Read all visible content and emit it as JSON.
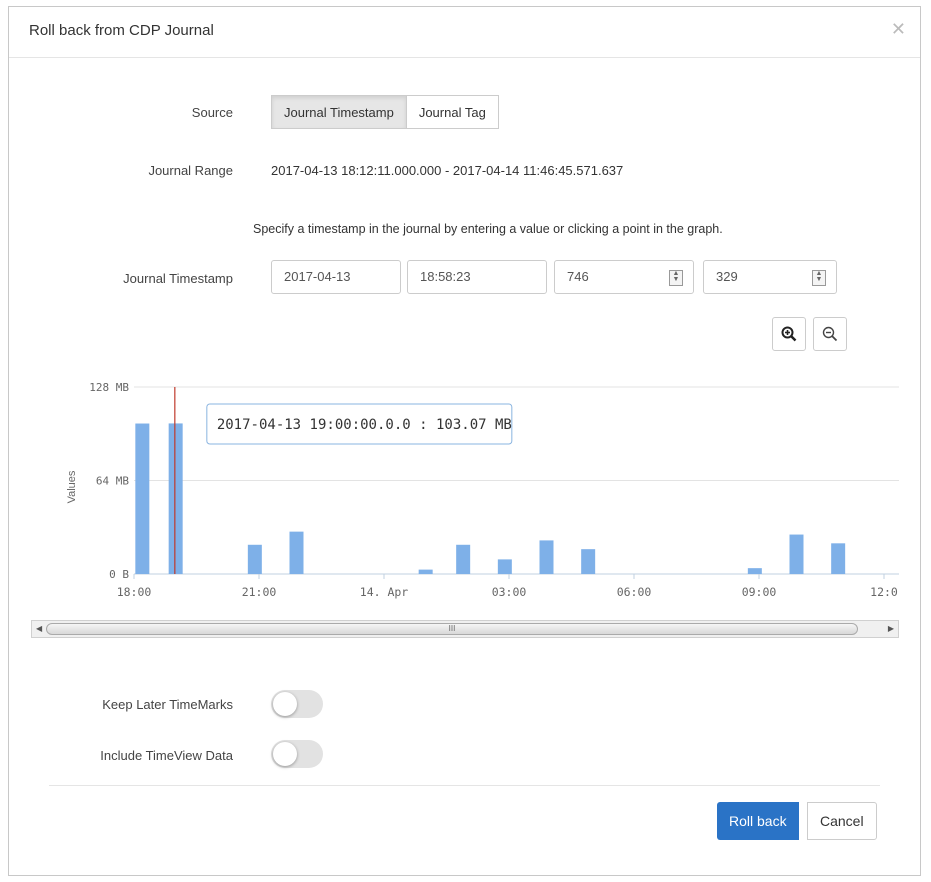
{
  "dialog": {
    "title": "Roll back from CDP Journal",
    "close_icon": "close-icon"
  },
  "source": {
    "label": "Source",
    "options": [
      "Journal Timestamp",
      "Journal Tag"
    ],
    "selected": "Journal Timestamp"
  },
  "journal_range": {
    "label": "Journal Range",
    "value": "2017-04-13 18:12:11.000.000 - 2017-04-14 11:46:45.571.637"
  },
  "hint": "Specify a timestamp in the journal by entering a value or clicking a point in the graph.",
  "journal_timestamp": {
    "label": "Journal Timestamp",
    "date": "2017-04-13",
    "time": "18:58:23",
    "ms": "746",
    "us": "329"
  },
  "zoom": {
    "zoom_in_icon": "zoom-in-icon",
    "zoom_out_icon": "zoom-out-icon"
  },
  "chart_data": {
    "type": "bar",
    "ylabel": "Values",
    "yticks": [
      "0 B",
      "64 MB",
      "128 MB"
    ],
    "ylim": [
      0,
      128
    ],
    "xticks": [
      "18:00",
      "21:00",
      "14. Apr",
      "03:00",
      "06:00",
      "09:00",
      "12:0"
    ],
    "x_hours_ticks": [
      18,
      21,
      24,
      27,
      30,
      33,
      36
    ],
    "bars": [
      {
        "x": 18.2,
        "value": 103
      },
      {
        "x": 19.0,
        "value": 103.07
      },
      {
        "x": 20.9,
        "value": 20
      },
      {
        "x": 21.9,
        "value": 29
      },
      {
        "x": 25.0,
        "value": 3
      },
      {
        "x": 25.9,
        "value": 20
      },
      {
        "x": 26.9,
        "value": 10
      },
      {
        "x": 27.9,
        "value": 23
      },
      {
        "x": 28.9,
        "value": 17
      },
      {
        "x": 32.9,
        "value": 4
      },
      {
        "x": 33.9,
        "value": 27
      },
      {
        "x": 34.9,
        "value": 21
      }
    ],
    "cursor_x": 18.98,
    "tooltip": "2017-04-13 19:00:00.0.0 : 103.07 MB",
    "bar_color": "#7eb0e8",
    "grid": true
  },
  "scrollbar": {
    "grip": "III"
  },
  "options": {
    "keep_later_label": "Keep Later TimeMarks",
    "keep_later_on": false,
    "include_timeview_label": "Include TimeView Data",
    "include_timeview_on": false
  },
  "footer": {
    "rollback_label": "Roll back",
    "cancel_label": "Cancel"
  }
}
